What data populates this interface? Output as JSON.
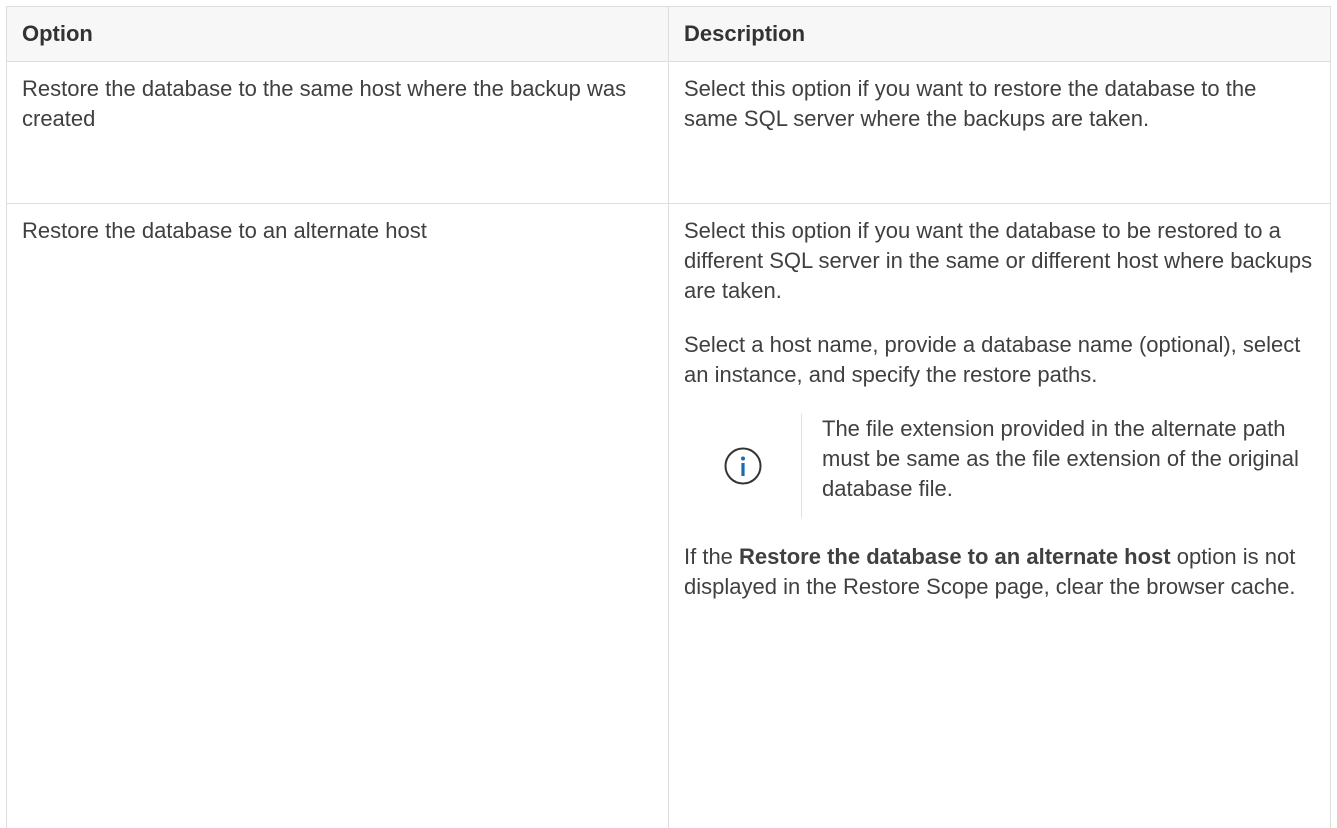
{
  "table": {
    "headers": {
      "option": "Option",
      "description": "Description"
    },
    "rows": [
      {
        "option": "Restore the database to the same host where the backup was created",
        "description": "Select this option if you want to restore the database to the same SQL server where the backups are taken."
      },
      {
        "option": "Restore the database to an alternate host",
        "description": "Select this option if you want the database to be restored to a different SQL server in the same or different host where backups are taken.",
        "description_2": "Select a host name, provide a database name (optional), select an instance, and specify the restore paths.",
        "note": {
          "icon": "info-icon",
          "text": "The file extension provided in the alternate path must be same as the file extension of the original database file."
        },
        "tip": {
          "prefix": "If the ",
          "bold": "Restore the database to an alternate host",
          "suffix": " option is not displayed in the Restore Scope page, clear the browser cache."
        }
      }
    ]
  },
  "colors": {
    "text": "#404040",
    "header_bg": "#f7f7f7",
    "border": "#dedede",
    "icon": "#1a6ab0"
  }
}
